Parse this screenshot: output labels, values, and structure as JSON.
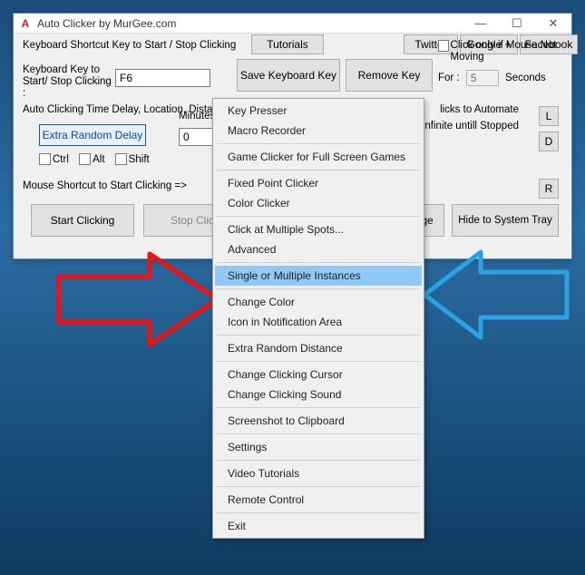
{
  "window": {
    "title": "Auto Clicker by MurGee.com"
  },
  "tabs": {
    "tutorials": "Tutorials",
    "twitter": "Twitter",
    "google": "Google +",
    "facebook": "Facebook"
  },
  "shortcut": {
    "label": "Keyboard Shortcut Key to Start / Stop Clicking",
    "key_label": "Keyboard Key to Start/ Stop Clicking :",
    "key_value": "F6",
    "save_btn": "Save Keyboard Key",
    "remove_btn": "Remove Key"
  },
  "click_only": {
    "label": "Click only if Mouse Not Moving",
    "for": "For :",
    "value": "5",
    "seconds": "Seconds"
  },
  "delay": {
    "label": "Auto Clicking Time Delay, Location, Distance, Number of Clicks etc",
    "extra_random": "Extra Random Delay",
    "ctrl": "Ctrl",
    "alt": "Alt",
    "shift": "Shift",
    "minutes_label": "Minutes",
    "minutes_value": "0",
    "clicks_label": "licks to Automate",
    "infinite": "0 => Infinite untill Stopped",
    "l_btn": "L",
    "d_btn": "D"
  },
  "mouse_shortcut": {
    "label": "Mouse Shortcut to Start Clicking =>",
    "r_btn": "R"
  },
  "actions": {
    "start": "Start Clicking",
    "stop": "Stop Click",
    "ge": "ge",
    "hide": "Hide to System Tray"
  },
  "menu": {
    "items": [
      "Key Presser",
      "Macro Recorder",
      "Game Clicker for Full Screen Games",
      "Fixed Point Clicker",
      "Color Clicker",
      "Click at Multiple Spots...",
      "Advanced",
      "Single or Multiple Instances",
      "Change Color",
      "Icon in Notification Area",
      "Extra Random Distance",
      "Change Clicking Cursor",
      "Change Clicking Sound",
      "Screenshot to Clipboard",
      "Settings",
      "Video Tutorials",
      "Remote Control",
      "Exit"
    ],
    "selected_index": 7,
    "separators_after": [
      1,
      2,
      4,
      6,
      7,
      9,
      10,
      12,
      13,
      14,
      15,
      16
    ]
  }
}
